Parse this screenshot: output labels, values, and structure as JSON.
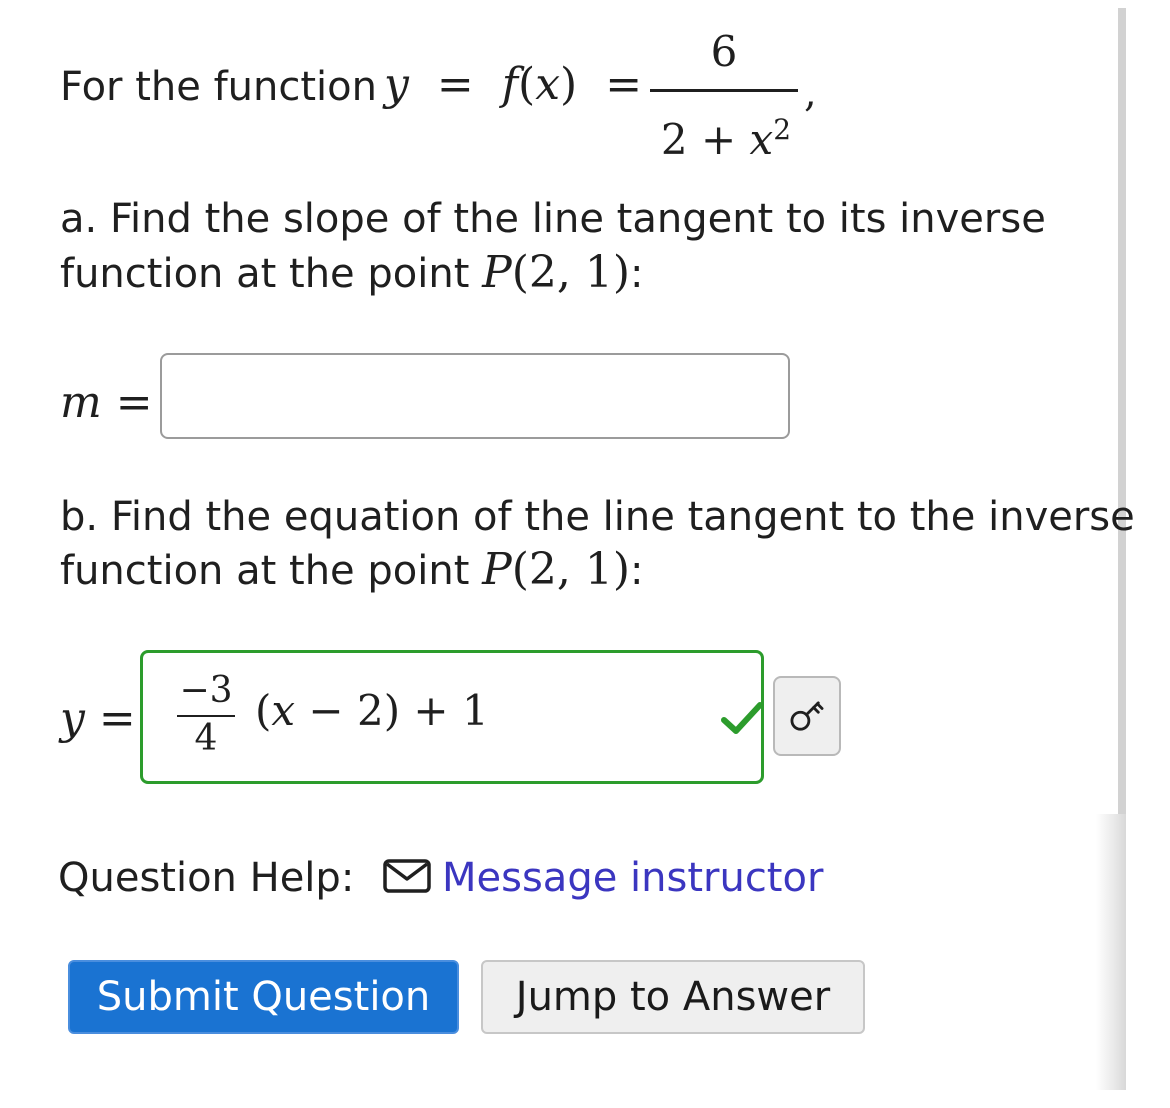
{
  "intro": {
    "label": "For the function",
    "expr_lhs": "y",
    "eq1": "=",
    "fname": "f",
    "lparen": "(",
    "arg": "x",
    "rparen": ")",
    "eq2": "=",
    "numerator": "6",
    "denominator_a": "2 + ",
    "denominator_b": "x",
    "denominator_exp": "2",
    "trailing": ","
  },
  "part_a": {
    "line1": "a. Find the slope of the line tangent to its inverse",
    "line2_text": "function at the point ",
    "point_name": "P",
    "point_coords": "(2, 1)",
    "colon": ":",
    "var": "m",
    "eq": "=",
    "answer_value": ""
  },
  "part_b": {
    "line1": "b. Find the equation of the line tangent to the inverse",
    "line2_text": "function at the point ",
    "point_name": "P",
    "point_coords": "(2, 1)",
    "colon": ":",
    "var": "y",
    "eq": "=",
    "answer": {
      "frac_num": "−3",
      "frac_den": "4",
      "rest_open": "(",
      "rest_var": "x",
      "rest_after": " − 2) + 1"
    },
    "status": "correct",
    "status_color": "#2c9c2c",
    "check_icon": "check-icon",
    "key_icon": "key-icon"
  },
  "help": {
    "label": "Question Help:",
    "icon": "envelope-icon",
    "link_text": "Message instructor",
    "link_color": "#3b36c0"
  },
  "buttons": {
    "submit": "Submit Question",
    "submit_color": "#1a73d2",
    "jump": "Jump to Answer"
  }
}
